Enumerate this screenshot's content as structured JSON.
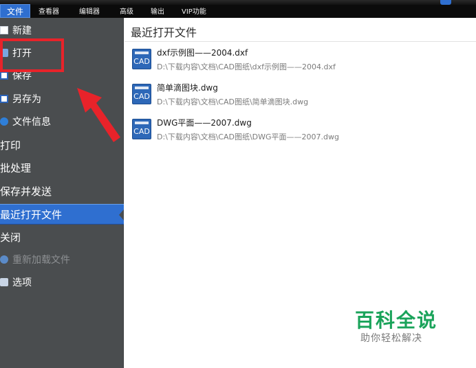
{
  "menubar": {
    "items": [
      "文件",
      "查看器",
      "编辑器",
      "高级",
      "输出",
      "VIP功能"
    ]
  },
  "sidebar": {
    "items": [
      {
        "label": "新建",
        "icon": "new-document-icon"
      },
      {
        "label": "打开",
        "icon": "open-file-icon"
      },
      {
        "label": "保存",
        "icon": "save-icon"
      },
      {
        "label": "另存为",
        "icon": "save-as-icon"
      },
      {
        "label": "文件信息",
        "icon": "file-info-icon"
      },
      {
        "label": "打印"
      },
      {
        "label": "批处理"
      },
      {
        "label": "保存并发送"
      },
      {
        "label": "最近打开文件",
        "selected": true
      },
      {
        "label": "关闭"
      },
      {
        "label": "重新加载文件",
        "icon": "reload-icon",
        "disabled": true
      },
      {
        "label": "选项",
        "icon": "options-wrench-icon"
      }
    ]
  },
  "main": {
    "title": "最近打开文件",
    "files": [
      {
        "name": "dxf示例图——2004.dxf",
        "path": "D:\\下载内容\\文档\\CAD图纸\\dxf示例图——2004.dxf",
        "icon_label": "CAD"
      },
      {
        "name": "简单滴图块.dwg",
        "path": "D:\\下载内容\\文档\\CAD图纸\\简单滴图块.dwg",
        "icon_label": "CAD"
      },
      {
        "name": "DWG平面——2007.dwg",
        "path": "D:\\下载内容\\文档\\CAD图纸\\DWG平面——2007.dwg",
        "icon_label": "CAD"
      }
    ]
  },
  "watermark": {
    "title": "百科全说",
    "subtitle": "助你轻松解决"
  },
  "colors": {
    "menubar_bg": "#0b0b0b",
    "accent": "#2f6fd0",
    "sidebar_bg": "#4a4d4f",
    "annotation_red": "#e8232a",
    "watermark_green": "#1aa35a"
  }
}
